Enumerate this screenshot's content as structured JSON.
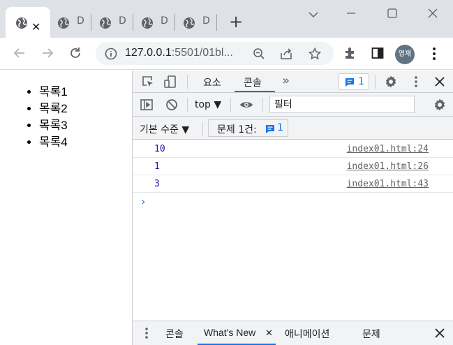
{
  "browser": {
    "tabs": [
      {
        "letter": "",
        "active": true
      },
      {
        "letter": "D"
      },
      {
        "letter": "D"
      },
      {
        "letter": "D"
      },
      {
        "letter": "D"
      }
    ],
    "url_host": "127.0.0.1",
    "url_rest": ":5501/01bl...",
    "profile_label": "영재"
  },
  "page": {
    "list_items": [
      "목록1",
      "목록2",
      "목록3",
      "목록4"
    ]
  },
  "devtools": {
    "tab_elements": "요소",
    "tab_console": "콘솔",
    "more_tabs": "»",
    "issue_count": "1",
    "context": "top ▼",
    "filter_placeholder": "필터",
    "levels": "기본 수준 ▼",
    "issues_label": "문제 1건:",
    "issues_count": "1",
    "logs": [
      {
        "value": "10",
        "source": "index01.html:24"
      },
      {
        "value": "1",
        "source": "index01.html:26"
      },
      {
        "value": "3",
        "source": "index01.html:43"
      }
    ],
    "prompt": "›",
    "drawer_tabs": [
      "콘솔",
      "What's New",
      "애니메이션",
      "문제"
    ]
  },
  "colors": {
    "accent": "#1a73e8",
    "chrome_bg": "#dee1e6",
    "toolbar_bg": "#f1f3f4"
  }
}
